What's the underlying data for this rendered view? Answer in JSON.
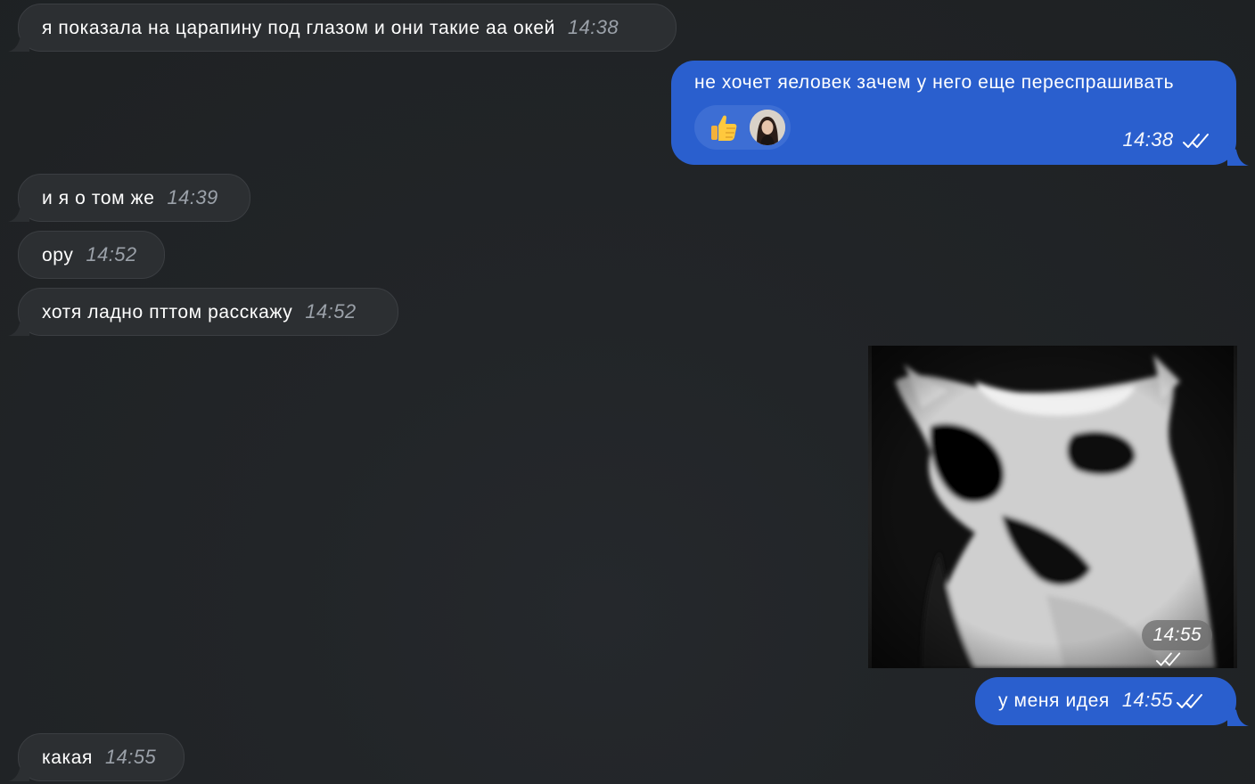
{
  "messages": [
    {
      "direction": "in",
      "text": "я показала на царапину под глазом и они такие аа окей",
      "time": "14:38"
    },
    {
      "direction": "out",
      "text": "не хочет яеловек зачем у него еще переспрашивать",
      "time": "14:38",
      "reaction": {
        "emoji": "thumbs-up-icon",
        "reactor": "avatar"
      }
    },
    {
      "direction": "in",
      "text": "и я о том же",
      "time": "14:39"
    },
    {
      "direction": "in",
      "text": "ору",
      "time": "14:52"
    },
    {
      "direction": "in",
      "text": "хотя ладно пттом расскажу",
      "time": "14:52"
    },
    {
      "direction": "out",
      "type": "image",
      "subject": "black-and-white cat photo",
      "time": "14:55"
    },
    {
      "direction": "out",
      "text": "у меня идея",
      "time": "14:55"
    },
    {
      "direction": "in",
      "text": "какая",
      "time": "14:55"
    }
  ],
  "colors": {
    "background": "#222528",
    "incoming_bubble": "#2c2f32",
    "outgoing_bubble": "#2a5fce",
    "incoming_time": "#9ba1a9"
  },
  "icons": {
    "read_status": "double-check-icon",
    "reaction": "thumbs-up-icon"
  }
}
